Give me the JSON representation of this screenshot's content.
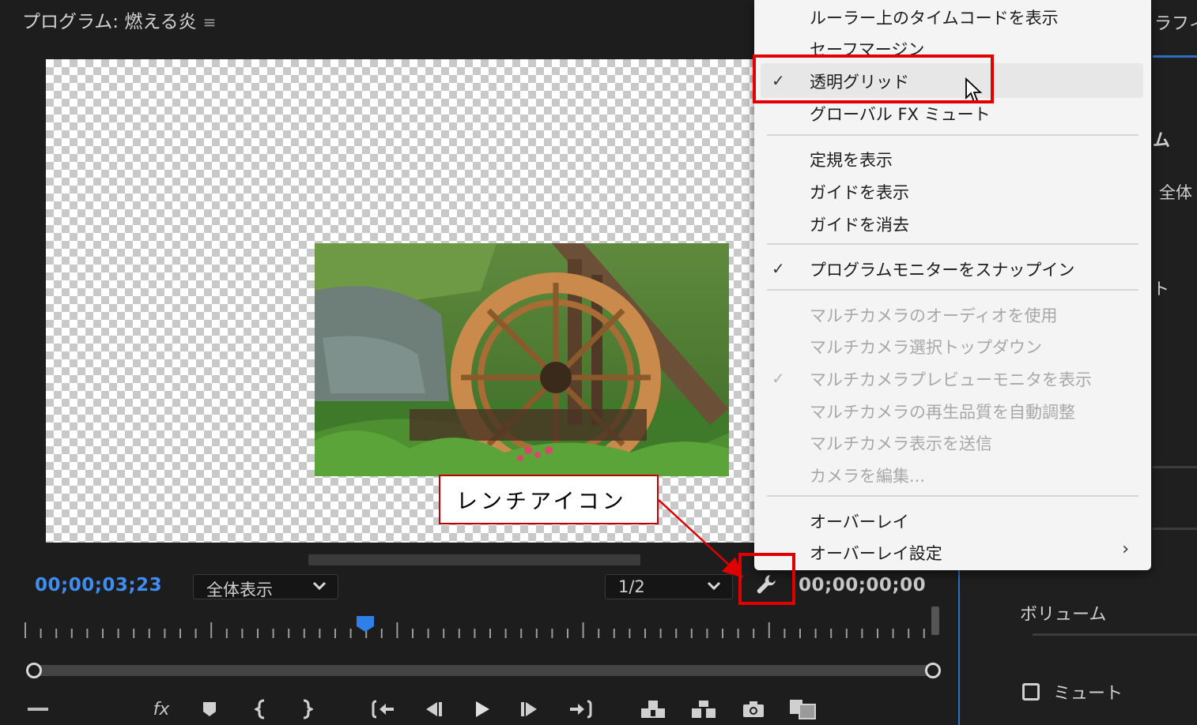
{
  "panel": {
    "title": "プログラム: 燃える炎",
    "title_menu_glyph": "≡",
    "current_timecode": "00;00;03;23",
    "duration_timecode": "00;00;00;00",
    "zoom_select": "全体表示",
    "resolution_select": "1/2"
  },
  "context_menu": {
    "items": [
      {
        "label": "ルーラー上のタイムコードを表示",
        "checked": false,
        "enabled": true
      },
      {
        "label": "セーフマージン",
        "checked": false,
        "enabled": true
      },
      {
        "label": "透明グリッド",
        "checked": true,
        "enabled": true,
        "highlighted": true
      },
      {
        "label": "グローバル FX ミュート",
        "checked": false,
        "enabled": true
      },
      {
        "label": "定規を表示",
        "checked": false,
        "enabled": true
      },
      {
        "label": "ガイドを表示",
        "checked": false,
        "enabled": true
      },
      {
        "label": "ガイドを消去",
        "checked": false,
        "enabled": true
      },
      {
        "label": "プログラムモニターをスナップイン",
        "checked": true,
        "enabled": true
      },
      {
        "label": "マルチカメラのオーディオを使用",
        "checked": false,
        "enabled": false
      },
      {
        "label": "マルチカメラ選択トップダウン",
        "checked": false,
        "enabled": false
      },
      {
        "label": "マルチカメラプレビューモニタを表示",
        "checked": true,
        "enabled": false
      },
      {
        "label": "マルチカメラの再生品質を自動調整",
        "checked": false,
        "enabled": false
      },
      {
        "label": "マルチカメラ表示を送信",
        "checked": false,
        "enabled": false
      },
      {
        "label": "カメラを編集...",
        "checked": false,
        "enabled": false
      },
      {
        "label": "オーバーレイ",
        "checked": false,
        "enabled": true
      },
      {
        "label": "オーバーレイ設定",
        "checked": false,
        "enabled": true,
        "submenu": true
      }
    ],
    "check_glyph": "✓",
    "submenu_glyph": "›"
  },
  "annotation": {
    "callout_text": "レンチアイコン",
    "color": "#e00000"
  },
  "right_panel": {
    "title_fragment": "ラフィ",
    "heading_fragment": "ム",
    "label_zentai": "全体",
    "label_to": "ト",
    "volume_label": "ボリューム",
    "mute_label": "ミュート"
  },
  "controls": {
    "fx_label": "fx",
    "icons": [
      "marker-icon",
      "mark-in-icon",
      "mark-out-icon",
      "go-to-in-icon",
      "step-back-icon",
      "play-icon",
      "step-forward-icon",
      "go-to-out-icon",
      "lift-icon",
      "extract-icon",
      "export-frame-icon",
      "comparison-view-icon"
    ]
  },
  "colors": {
    "accent_blue": "#3f8df0",
    "panel_bg": "#1d1d1d",
    "menu_bg": "#f4f4f4"
  }
}
